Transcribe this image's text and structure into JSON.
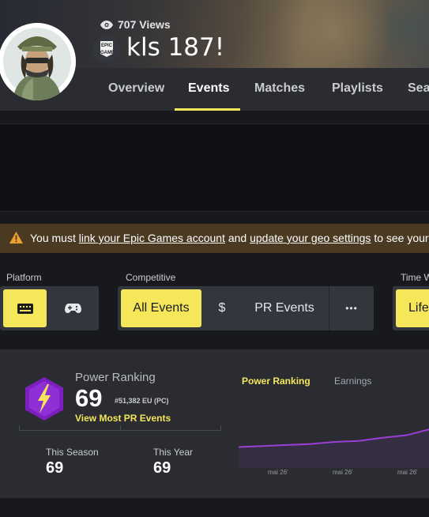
{
  "header": {
    "views": "707 Views",
    "username": "kls 187!",
    "platform_badge": "EPIC GAMES"
  },
  "nav": {
    "tabs": [
      "Overview",
      "Events",
      "Matches",
      "Playlists",
      "Sea"
    ],
    "active": "Events"
  },
  "warning": {
    "prefix": "You must ",
    "link1": "link your Epic Games account",
    "middle": " and ",
    "link2": "update your geo settings",
    "suffix": " to see your"
  },
  "filters": {
    "platform_label": "Platform",
    "competitive_label": "Competitive",
    "time_label": "Time W",
    "all_events": "All Events",
    "dollar": "$",
    "pr_events": "PR Events",
    "more": "•••",
    "lifetime": "Life"
  },
  "power_ranking": {
    "label": "Power Ranking",
    "value": "69",
    "rank": "#51,382 EU (PC)",
    "link": "View Most PR Events",
    "season_label": "This Season",
    "season_value": "69",
    "year_label": "This Year",
    "year_value": "69"
  },
  "chart_tabs": {
    "active": "Power Ranking",
    "inactive": "Earnings"
  },
  "chart_data": {
    "type": "line",
    "title": "",
    "x": [
      "mai 26'",
      "mai 26'",
      "mai 26'"
    ],
    "series": [
      {
        "values": [
          10,
          12,
          14,
          16,
          20,
          22,
          28,
          33,
          45
        ]
      }
    ],
    "color": "#9b3ed6",
    "grid": false
  },
  "colors": {
    "accent": "#f5e65a",
    "pr_purple": "#7b1fbf",
    "line": "#9b3ed6"
  }
}
